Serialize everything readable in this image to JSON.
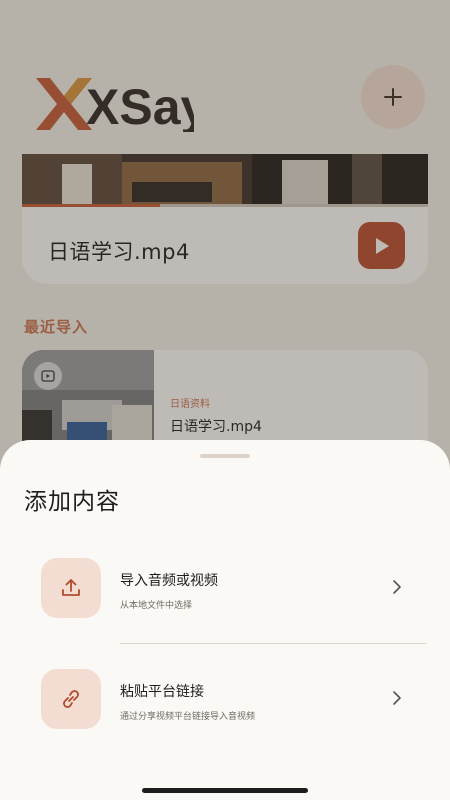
{
  "app": {
    "logo_text": "XSay"
  },
  "header": {
    "add_button_symbol": "+"
  },
  "current_video": {
    "title": "日语学习.mp4",
    "progress": 0.34
  },
  "recent": {
    "section_title": "最近导入",
    "items": [
      {
        "tag": "日语资料",
        "title": "日语学习.mp4"
      }
    ]
  },
  "sheet": {
    "title": "添加内容",
    "options": [
      {
        "title": "导入音频或视频",
        "subtitle": "从本地文件中选择",
        "icon": "upload-icon"
      },
      {
        "title": "粘贴平台链接",
        "subtitle": "通过分享视频平台链接导入音视频",
        "icon": "link-icon"
      }
    ]
  },
  "colors": {
    "accent": "#c35a37",
    "accent_soft": "#f3ddd3",
    "logo_dark": "#2b2522"
  }
}
